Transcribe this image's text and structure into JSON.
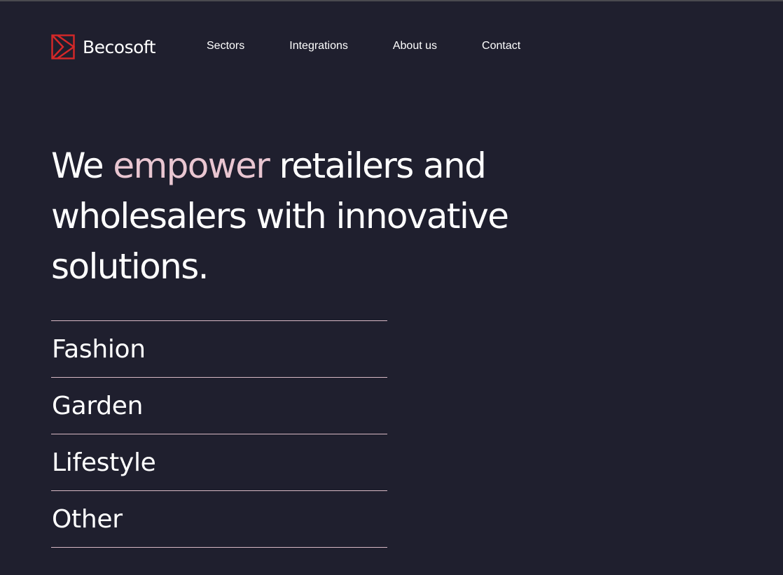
{
  "brand": {
    "name": "Becosoft",
    "logo_color": "#d62828"
  },
  "nav": {
    "items": [
      {
        "label": "Sectors"
      },
      {
        "label": "Integrations"
      },
      {
        "label": "About us"
      },
      {
        "label": "Contact"
      }
    ]
  },
  "hero": {
    "prefix": "We ",
    "accent": "empower",
    "suffix": " retailers and wholesalers with innovative solutions.",
    "accent_color": "#e9c6d1"
  },
  "sectors": {
    "items": [
      {
        "label": "Fashion"
      },
      {
        "label": "Garden"
      },
      {
        "label": "Lifestyle"
      },
      {
        "label": "Other"
      }
    ]
  },
  "theme": {
    "background": "#1f1f2e",
    "divider": "#d8b9c4"
  }
}
